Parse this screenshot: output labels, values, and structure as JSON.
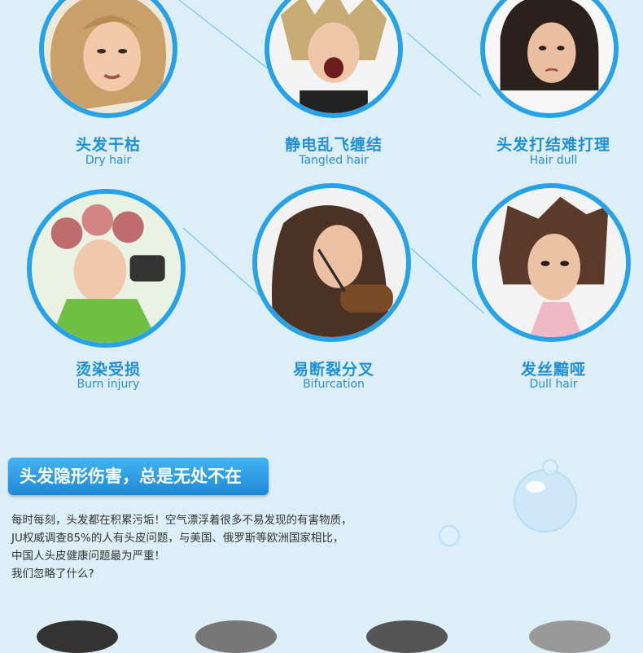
{
  "items": [
    {
      "cn": "头发干枯",
      "en": "Dry hair"
    },
    {
      "cn": "静电乱飞缠结",
      "en": "Tangled hair"
    },
    {
      "cn": "头发打结难打理",
      "en": "Hair dull"
    },
    {
      "cn": "烫染受损",
      "en": "Burn injury"
    },
    {
      "cn": "易断裂分叉",
      "en": "Bifurcation"
    },
    {
      "cn": "发丝黯哑",
      "en": "Dull hair"
    }
  ],
  "banner": {
    "title": "头发隐形伤害，总是无处不在"
  },
  "paragraph": {
    "lines": [
      "每时每刻，头发都在积累污垢！空气漂浮着很多不易发现的有害物质，",
      "JU权威调查85%的人有头皮问题，与美国、俄罗斯等欧洲国家相比，",
      "中国人头皮健康问题最为严重！",
      "我们忽略了什么?"
    ]
  },
  "colors": {
    "accent": "#27a2e6",
    "label": "#1f8fd6",
    "background": "#dceff9"
  }
}
